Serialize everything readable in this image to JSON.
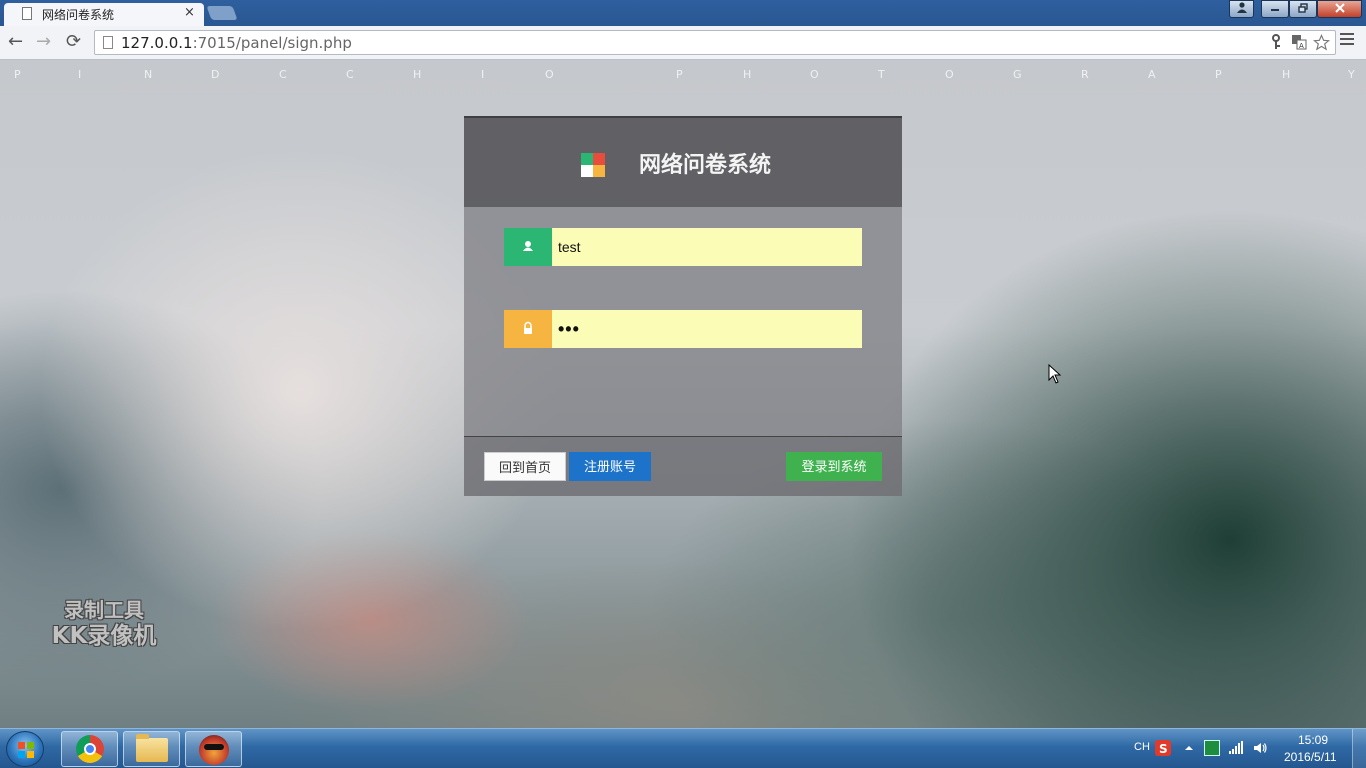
{
  "browser": {
    "tab_title": "网络问卷系统",
    "tab_close": "×",
    "url_host": "127.0.0.1",
    "url_rest": ":7015/panel/sign.php",
    "nav": {
      "back": "←",
      "forward": "→",
      "reload": "⟳"
    }
  },
  "banner": {
    "letters": [
      "P",
      "I",
      "N",
      "D",
      "C",
      "C",
      "H",
      "I",
      "O",
      "P",
      "H",
      "O",
      "T",
      "O",
      "G",
      "R",
      "A",
      "P",
      "H",
      "Y"
    ]
  },
  "panel": {
    "title": "网络问卷系统",
    "logo_colors": [
      "#2bb673",
      "#e74c3c",
      "#ffffff",
      "#f5b540"
    ],
    "username_value": "test",
    "password_value": "•••",
    "buttons": {
      "home": "回到首页",
      "register": "注册账号",
      "login": "登录到系统"
    },
    "colors": {
      "user_addon": "#2bb673",
      "pass_addon": "#f5b540",
      "input_bg": "#fbfdb7",
      "register_btn": "#1c73c9",
      "login_btn": "#3fb24f"
    }
  },
  "watermark": {
    "line1": "录制工具",
    "line2": "KK录像机"
  },
  "taskbar": {
    "apps": [
      "chrome-icon",
      "explorer-folder-icon",
      "kk-recorder-icon"
    ],
    "tray": {
      "lang": "CH",
      "time": "15:09",
      "date": "2016/5/11"
    }
  }
}
